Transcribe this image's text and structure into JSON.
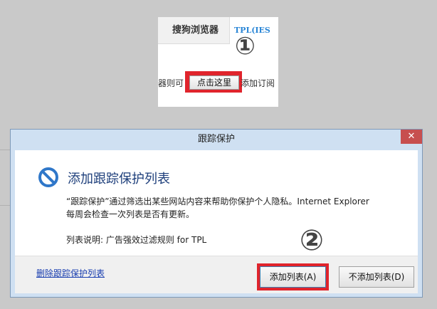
{
  "snippet": {
    "tab1": "搜狗浏览器",
    "tab2": "TPL(IES",
    "left_text": "器则可",
    "button": "点击这里",
    "right_text": "添加订阅",
    "step1": "①"
  },
  "dialog": {
    "title": "跟踪保护",
    "close": "✕",
    "heading": "添加跟踪保护列表",
    "desc_line1": "“跟踪保护”通过筛选出某些网站内容来帮助你保护个人隐私。Internet Explorer",
    "desc_line2": "每周会检查一次列表是否有更新。",
    "list_desc": "列表说明: 广告强效过滤规则 for TPL",
    "delete_link": "删除跟踪保护列表",
    "add_button": "添加列表(A)",
    "no_add_button": "不添加列表(D)",
    "step2": "②"
  },
  "colors": {
    "highlight": "#e0242c",
    "heading": "#1e3f7b",
    "link": "#1a3fb0",
    "block_icon": "#2f77c9"
  }
}
